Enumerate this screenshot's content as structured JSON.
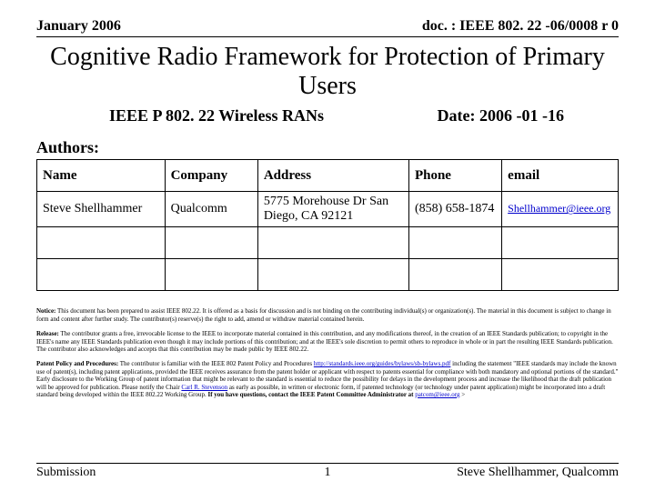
{
  "header": {
    "date_label": "January 2006",
    "doc_label": "doc. : IEEE 802. 22 -06/0008 r 0"
  },
  "title": "Cognitive Radio Framework for Protection of Primary Users",
  "subhead": {
    "group": "IEEE P 802. 22 Wireless RANs",
    "date": "Date: 2006 -01 -16"
  },
  "authors_label": "Authors:",
  "table": {
    "headers": [
      "Name",
      "Company",
      "Address",
      "Phone",
      "email"
    ],
    "rows": [
      {
        "name": "Steve Shellhammer",
        "company": "Qualcomm",
        "address": "5775 Morehouse Dr San Diego, CA 92121",
        "phone": "(858) 658-1874",
        "email": "Shellhammer@ieee.org"
      },
      {
        "name": "",
        "company": "",
        "address": "",
        "phone": "",
        "email": ""
      },
      {
        "name": "",
        "company": "",
        "address": "",
        "phone": "",
        "email": ""
      }
    ]
  },
  "fineprint": {
    "notice_lead": "Notice:",
    "notice": " This document has been prepared to assist IEEE 802.22. It is offered as a basis for discussion and is not binding on the contributing individual(s) or organization(s). The material in this document is subject to change in form and content after further study. The contributor(s) reserve(s) the right to add, amend or withdraw material contained herein.",
    "release_lead": "Release:",
    "release": " The contributor grants a free, irrevocable license to the IEEE to incorporate material contained in this contribution, and any modifications thereof, in the creation of an IEEE Standards publication; to copyright in the IEEE's name any IEEE Standards publication even though it may include portions of this contribution; and at the IEEE's sole discretion to permit others to reproduce in whole or in part the resulting IEEE Standards publication. The contributor also acknowledges and accepts that this contribution may be made public by IEEE 802.22.",
    "patent_lead": "Patent Policy and Procedures:",
    "patent_pre": " The contributor is familiar with the IEEE 802 Patent Policy and Procedures ",
    "patent_link1": "http://standards.ieee.org/guides/bylaws/sb-bylaws.pdf",
    "patent_mid": " including the statement \"IEEE standards may include the known use of patent(s), including patent applications, provided the IEEE receives assurance from the patent holder or applicant with respect to patents essential for compliance with both mandatory and optional portions of the standard.\" Early disclosure to the Working Group of patent information that might be relevant to the standard is essential to reduce the possibility for delays in the development process and increase the likelihood that the draft publication will be approved for publication. Please notify the Chair ",
    "patent_link2": "Carl R. Stevenson",
    "patent_post1": " as early as possible, in written or electronic form, if patented technology (or technology under patent application) might be incorporated into a draft standard being developed within the IEEE 802.22 Working Group. ",
    "patent_bold2": "If you have questions, contact the IEEE Patent Committee Administrator at ",
    "patent_link3": "patcom@ieee.org",
    "patent_tail": " >"
  },
  "footer": {
    "left": "Submission",
    "center": "1",
    "right": "Steve Shellhammer, Qualcomm"
  }
}
